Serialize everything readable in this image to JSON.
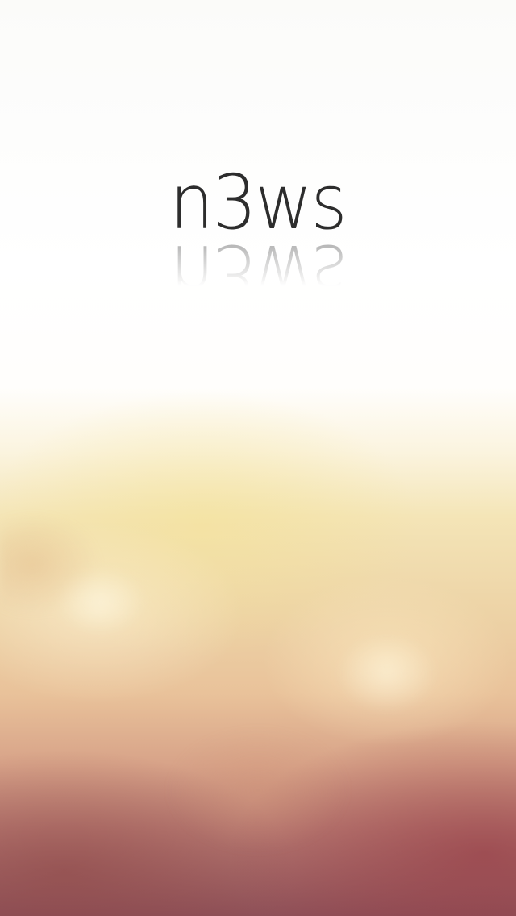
{
  "app": {
    "logo_text": "n3ws",
    "logo_reflection_text": "n3ws"
  },
  "colors": {
    "logo": "#2d2d2d",
    "background_top": "#fbfbf9",
    "background_mid": "#f4e5b7",
    "background_bottom": "#8e5058"
  }
}
